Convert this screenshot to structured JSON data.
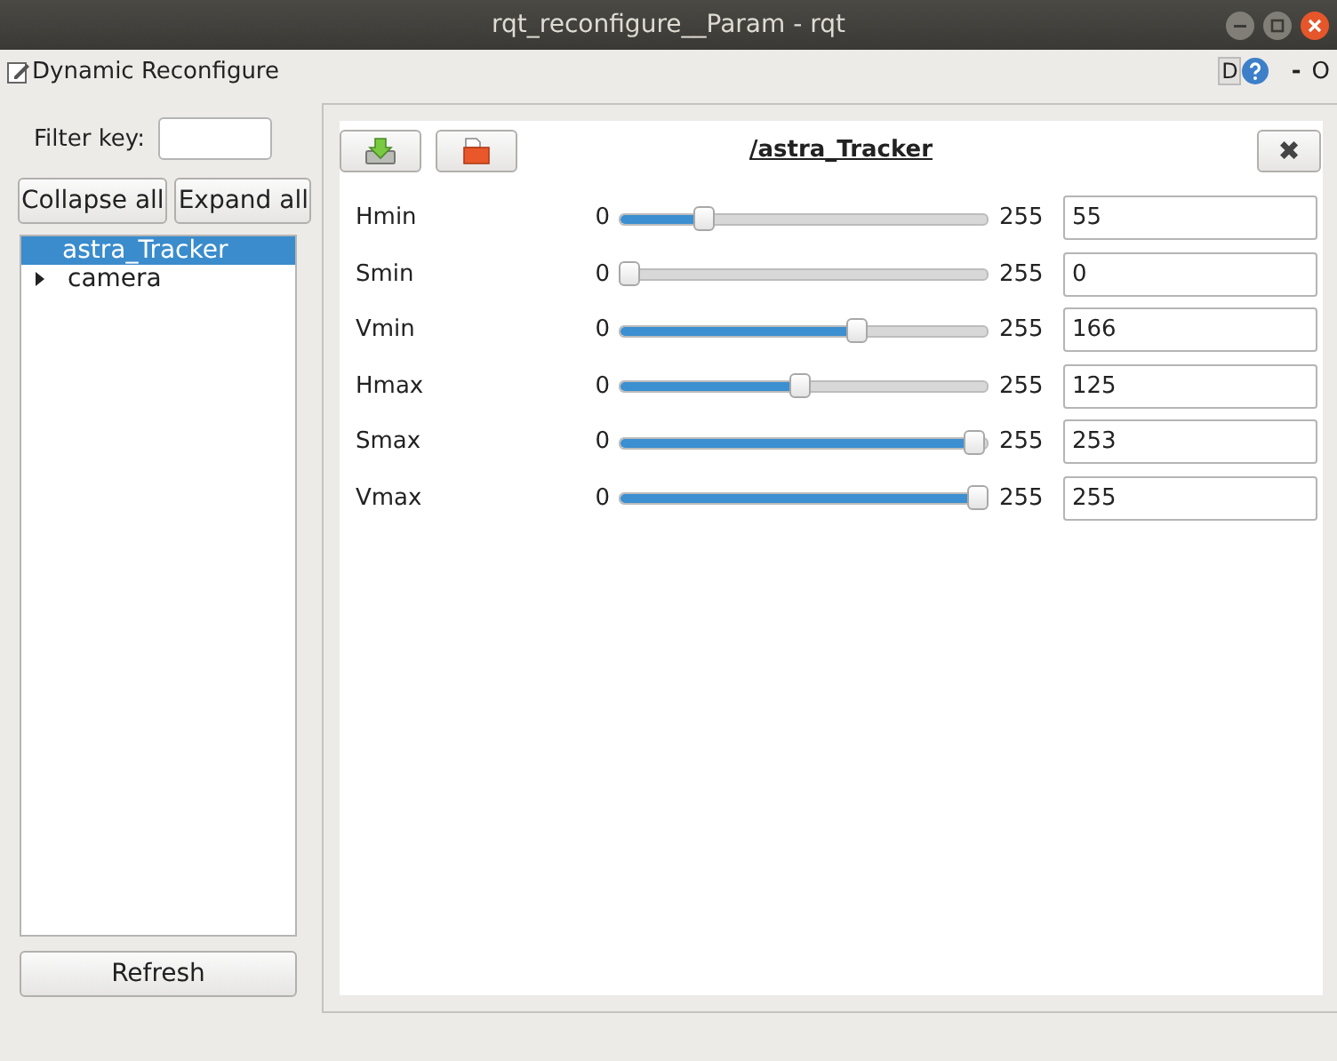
{
  "window": {
    "title": "rqt_reconfigure__Param - rqt"
  },
  "plugin_bar": {
    "title": "Dynamic Reconfigure",
    "help_letter": "D",
    "minimize": "-",
    "restore": "O"
  },
  "sidebar": {
    "filter_label": "Filter key:",
    "buttons": [
      "Collapse all",
      "Expand all"
    ],
    "tree": [
      {
        "label": "astra_Tracker",
        "selected": true
      },
      {
        "label": "camera",
        "selected": false,
        "expanded": false
      }
    ],
    "refresh": "Refresh"
  },
  "node": {
    "title": "/astra_Tracker",
    "close": "✖",
    "params": [
      {
        "name": "Hmin",
        "min": "0",
        "max": "255",
        "value": "55",
        "level": 0.216
      },
      {
        "name": "Smin",
        "min": "0",
        "max": "255",
        "value": "0",
        "level": 0
      },
      {
        "name": "Vmin",
        "min": "0",
        "max": "255",
        "value": "166",
        "level": 0.651
      },
      {
        "name": "Hmax",
        "min": "0",
        "max": "255",
        "value": "125",
        "level": 0.49
      },
      {
        "name": "Smax",
        "min": "0",
        "max": "255",
        "value": "253",
        "level": 0.992
      },
      {
        "name": "Vmax",
        "min": "0",
        "max": "255",
        "value": "255",
        "level": 1
      }
    ]
  }
}
